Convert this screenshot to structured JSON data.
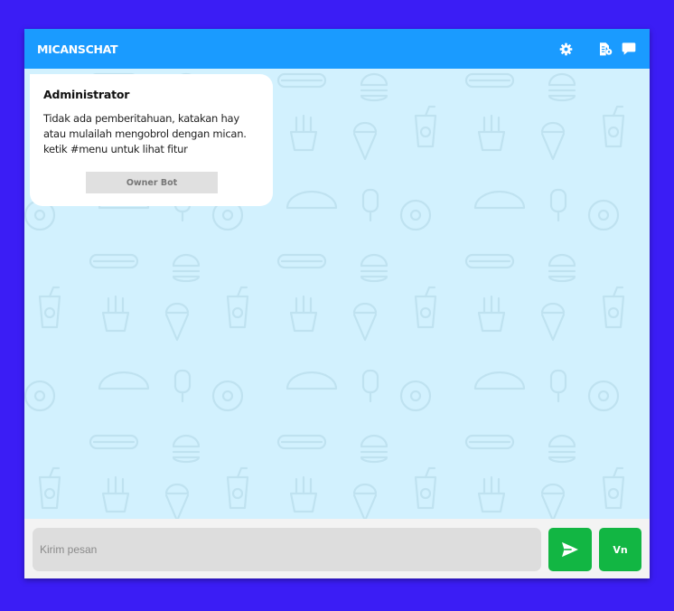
{
  "header": {
    "title": "MICANSCHAT",
    "icons": [
      "gear-icon",
      "file-settings-icon",
      "chat-bubble-icon"
    ]
  },
  "message": {
    "sender": "Administrator",
    "text": "Tidak ada pemberitahuan, katakan hay\natau mulailah mengobrol dengan mican.\nketik #menu untuk lihat fitur",
    "button_label": "Owner Bot"
  },
  "composer": {
    "placeholder": "Kirim pesan",
    "value": "",
    "send_icon": "send-icon",
    "vn_label": "Vn"
  },
  "colors": {
    "page_background": "#3b1df5",
    "header": "#1a9bff",
    "chat_background": "#d2f1fe",
    "pattern": "#bfe2f0",
    "button_green": "#12b643"
  }
}
